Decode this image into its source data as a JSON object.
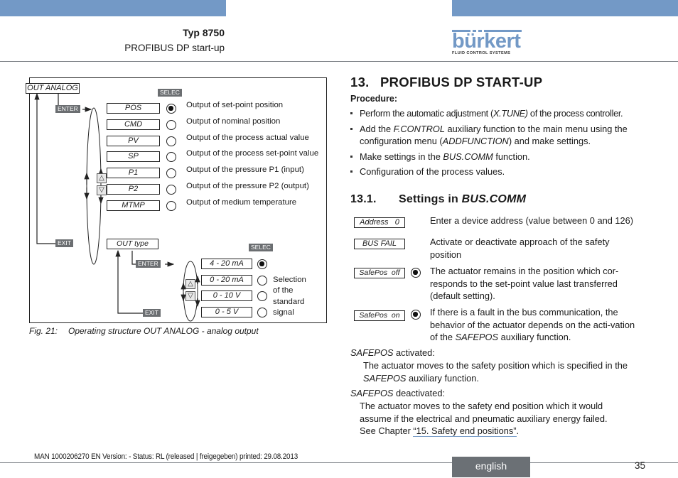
{
  "header": {
    "title": "Typ 8750",
    "subtitle": "PROFIBUS DP start-up",
    "logo": {
      "word": "bürkert",
      "tagline": "FLUID CONTROL SYSTEMS"
    },
    "accent_color": "#7399c6"
  },
  "figure": {
    "menu_root": "OUT ANALOG",
    "tags": {
      "enter": "ENTER",
      "exit": "EXIT",
      "selec": "SELEC"
    },
    "nav_icons": [
      "arrow-up-icon",
      "arrow-down-icon"
    ],
    "outputs": [
      {
        "code": "POS",
        "desc": "Output of set-point position",
        "selected": true
      },
      {
        "code": "CMD",
        "desc": "Output of nominal position",
        "selected": false
      },
      {
        "code": "PV",
        "desc": "Output of the process actual value",
        "selected": false
      },
      {
        "code": "SP",
        "desc": "Output of the process set-point value",
        "selected": false
      },
      {
        "code": "P1",
        "desc": "Output of the pressure P1 (input)",
        "selected": false
      },
      {
        "code": "P2",
        "desc": "Output of the pressure P2 (output)",
        "selected": false
      },
      {
        "code": "MTMP",
        "desc": "Output of medium temperature",
        "selected": false
      }
    ],
    "out_type": "OUT type",
    "signals": [
      {
        "label": "4 - 20 mA",
        "selected": true
      },
      {
        "label": "0 - 20 mA",
        "selected": false
      },
      {
        "label": "0 - 10 V",
        "selected": false
      },
      {
        "label": "0 - 5 V",
        "selected": false
      }
    ],
    "signal_note": [
      "Selection",
      "of the",
      "standard",
      "signal"
    ],
    "caption_label": "Fig. 21:",
    "caption_text": "Operating structure OUT ANALOG - analog output"
  },
  "section": {
    "number": "13.",
    "title": "PROFIBUS DP START-UP",
    "procedure_label": "Procedure:",
    "bullets": [
      {
        "pre": "Perform the automatic adjustment (",
        "em": "X.TUNE)",
        "post": " of the process controller."
      },
      {
        "pre": "Add the ",
        "em": "F.CONTROL",
        "post": " auxiliary function to the main menu using the configuration menu (",
        "em2": "ADDFUNCTION",
        "post2": ") and make settings."
      },
      {
        "pre": "Make settings in the ",
        "em": "BUS.COMM",
        "post": " function."
      },
      {
        "pre": "Configuration of the process values.",
        "em": "",
        "post": ""
      }
    ]
  },
  "subsection": {
    "number": "13.1.",
    "title_pre": "Settings in ",
    "title_em": "BUS.COMM",
    "settings": [
      {
        "box": "Address   0",
        "desc": "Enter a device address (value between 0 and 126)",
        "radio": false
      },
      {
        "box": "BUS FAIL",
        "desc": "Activate or deactivate approach of the safety position",
        "radio": false
      },
      {
        "box": "SafePos  off",
        "desc": "The actuator remains in the position which cor-responds to the set-point value last transferred (default setting).",
        "radio": true
      },
      {
        "box": "SafePos  on",
        "desc_pre": "If there is a fault in the bus communication, the behavior of the actuator depends on the acti-vation of the ",
        "desc_em": "SAFEPOS",
        "desc_post": " auxiliary function.",
        "radio": true
      }
    ],
    "activated_label_em": "SAFEPOS",
    "activated_label": " activated:",
    "activated_text_pre": "The actuator moves to the safety position which is specified in the ",
    "activated_text_em": "SAFEPOS",
    "activated_text_post": " auxiliary function.",
    "deactivated_label_em": "SAFEPOS",
    "deactivated_label": " deactivated:",
    "deactivated_text": "The actuator moves to the safety end position which it would assume if the electrical and pneumatic auxiliary energy failed.",
    "see_pre": "See Chapter ",
    "see_link": "“15. Safety end positions”",
    "see_post": "."
  },
  "footer": {
    "meta": "MAN  1000206270  EN  Version: - Status: RL (released | freigegeben)  printed: 29.08.2013",
    "language": "english",
    "page": "35"
  }
}
